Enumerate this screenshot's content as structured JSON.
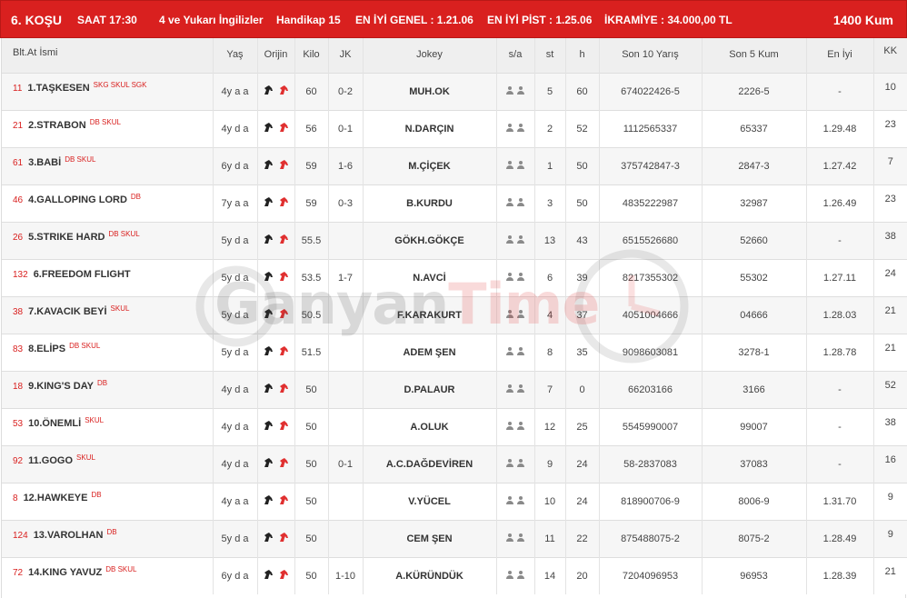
{
  "header": {
    "race_no": "6. KOŞU",
    "time": "SAAT 17:30",
    "category": "4 ve Yukarı İngilizler",
    "handicap": "Handikap 15",
    "best_general": "EN İYİ GENEL : 1.21.06",
    "best_track": "EN İYİ PİST : 1.25.06",
    "prize": "İKRAMİYE : 34.000,00 TL",
    "distance": "1400 Kum"
  },
  "columns": {
    "name": "Blt.At İsmi",
    "age": "Yaş",
    "origin": "Orijin",
    "weight": "Kilo",
    "jk": "JK",
    "jockey": "Jokey",
    "sa": "s/a",
    "st": "st",
    "h": "h",
    "last10": "Son 10 Yarış",
    "last5": "Son 5 Kum",
    "best": "En İyi",
    "kk": "KK"
  },
  "colors": {
    "brand": "#d9201f",
    "header_row": "#efefef",
    "row_alt": "#f6f6f6"
  },
  "icons": {
    "origin_sire": "black-horse-head-icon",
    "origin_dam": "red-horse-head-icon",
    "sa": "person-icon"
  },
  "watermark": {
    "part1": "Ganyan",
    "part2": "Time"
  },
  "rows": [
    {
      "no": "11",
      "horse": "1.TAŞKESEN",
      "tags": "SKG SKUL SGK",
      "age": "4y a a",
      "weight": "60",
      "jk": "0-2",
      "jockey": "MUH.OK",
      "st": "5",
      "h": "60",
      "last10": "674022426-5",
      "last5": "2226-5",
      "best": "-",
      "kk": "10"
    },
    {
      "no": "21",
      "horse": "2.STRABON",
      "tags": "DB SKUL",
      "age": "4y d a",
      "weight": "56",
      "jk": "0-1",
      "jockey": "N.DARÇIN",
      "st": "2",
      "h": "52",
      "last10": "1112565337",
      "last5": "65337",
      "best": "1.29.48",
      "kk": "23"
    },
    {
      "no": "61",
      "horse": "3.BABİ",
      "tags": "DB SKUL",
      "age": "6y d a",
      "weight": "59",
      "jk": "1-6",
      "jockey": "M.ÇİÇEK",
      "st": "1",
      "h": "50",
      "last10": "375742847-3",
      "last5": "2847-3",
      "best": "1.27.42",
      "kk": "7"
    },
    {
      "no": "46",
      "horse": "4.GALLOPING LORD",
      "tags": "DB",
      "age": "7y a a",
      "weight": "59",
      "jk": "0-3",
      "jockey": "B.KURDU",
      "st": "3",
      "h": "50",
      "last10": "4835222987",
      "last5": "32987",
      "best": "1.26.49",
      "kk": "23"
    },
    {
      "no": "26",
      "horse": "5.STRIKE HARD",
      "tags": "DB SKUL",
      "age": "5y d a",
      "weight": "55.5",
      "jk": "",
      "jockey": "GÖKH.GÖKÇE",
      "st": "13",
      "h": "43",
      "last10": "6515526680",
      "last5": "52660",
      "best": "-",
      "kk": "38"
    },
    {
      "no": "132",
      "horse": "6.FREEDOM FLIGHT",
      "tags": "",
      "age": "5y d a",
      "weight": "53.5",
      "jk": "1-7",
      "jockey": "N.AVCİ",
      "st": "6",
      "h": "39",
      "last10": "8217355302",
      "last5": "55302",
      "best": "1.27.11",
      "kk": "24"
    },
    {
      "no": "38",
      "horse": "7.KAVACIK BEYİ",
      "tags": "SKUL",
      "age": "5y d a",
      "weight": "50.5",
      "jk": "",
      "jockey": "F.KARAKURT",
      "st": "4",
      "h": "37",
      "last10": "4051004666",
      "last5": "04666",
      "best": "1.28.03",
      "kk": "21"
    },
    {
      "no": "83",
      "horse": "8.ELİPS",
      "tags": "DB SKUL",
      "age": "5y d a",
      "weight": "51.5",
      "jk": "",
      "jockey": "ADEM ŞEN",
      "st": "8",
      "h": "35",
      "last10": "9098603081",
      "last5": "3278-1",
      "best": "1.28.78",
      "kk": "21"
    },
    {
      "no": "18",
      "horse": "9.KING'S DAY",
      "tags": "DB",
      "age": "4y d a",
      "weight": "50",
      "jk": "",
      "jockey": "D.PALAUR",
      "st": "7",
      "h": "0",
      "last10": "66203166",
      "last5": "3166",
      "best": "-",
      "kk": "52"
    },
    {
      "no": "53",
      "horse": "10.ÖNEMLİ",
      "tags": "SKUL",
      "age": "4y d a",
      "weight": "50",
      "jk": "",
      "jockey": "A.OLUK",
      "st": "12",
      "h": "25",
      "last10": "5545990007",
      "last5": "99007",
      "best": "-",
      "kk": "38"
    },
    {
      "no": "92",
      "horse": "11.GOGO",
      "tags": "SKUL",
      "age": "4y d a",
      "weight": "50",
      "jk": "0-1",
      "jockey": "A.C.DAĞDEVİREN",
      "st": "9",
      "h": "24",
      "last10": "58-2837083",
      "last5": "37083",
      "best": "-",
      "kk": "16"
    },
    {
      "no": "8",
      "horse": "12.HAWKEYE",
      "tags": "DB",
      "age": "4y a a",
      "weight": "50",
      "jk": "",
      "jockey": "V.YÜCEL",
      "st": "10",
      "h": "24",
      "last10": "818900706-9",
      "last5": "8006-9",
      "best": "1.31.70",
      "kk": "9"
    },
    {
      "no": "124",
      "horse": "13.VAROLHAN",
      "tags": "DB",
      "age": "5y d a",
      "weight": "50",
      "jk": "",
      "jockey": "CEM ŞEN",
      "st": "11",
      "h": "22",
      "last10": "875488075-2",
      "last5": "8075-2",
      "best": "1.28.49",
      "kk": "9"
    },
    {
      "no": "72",
      "horse": "14.KING YAVUZ",
      "tags": "DB SKUL",
      "age": "6y d a",
      "weight": "50",
      "jk": "1-10",
      "jockey": "A.KÜRÜNDÜK",
      "st": "14",
      "h": "20",
      "last10": "7204096953",
      "last5": "96953",
      "best": "1.28.39",
      "kk": "21"
    }
  ]
}
